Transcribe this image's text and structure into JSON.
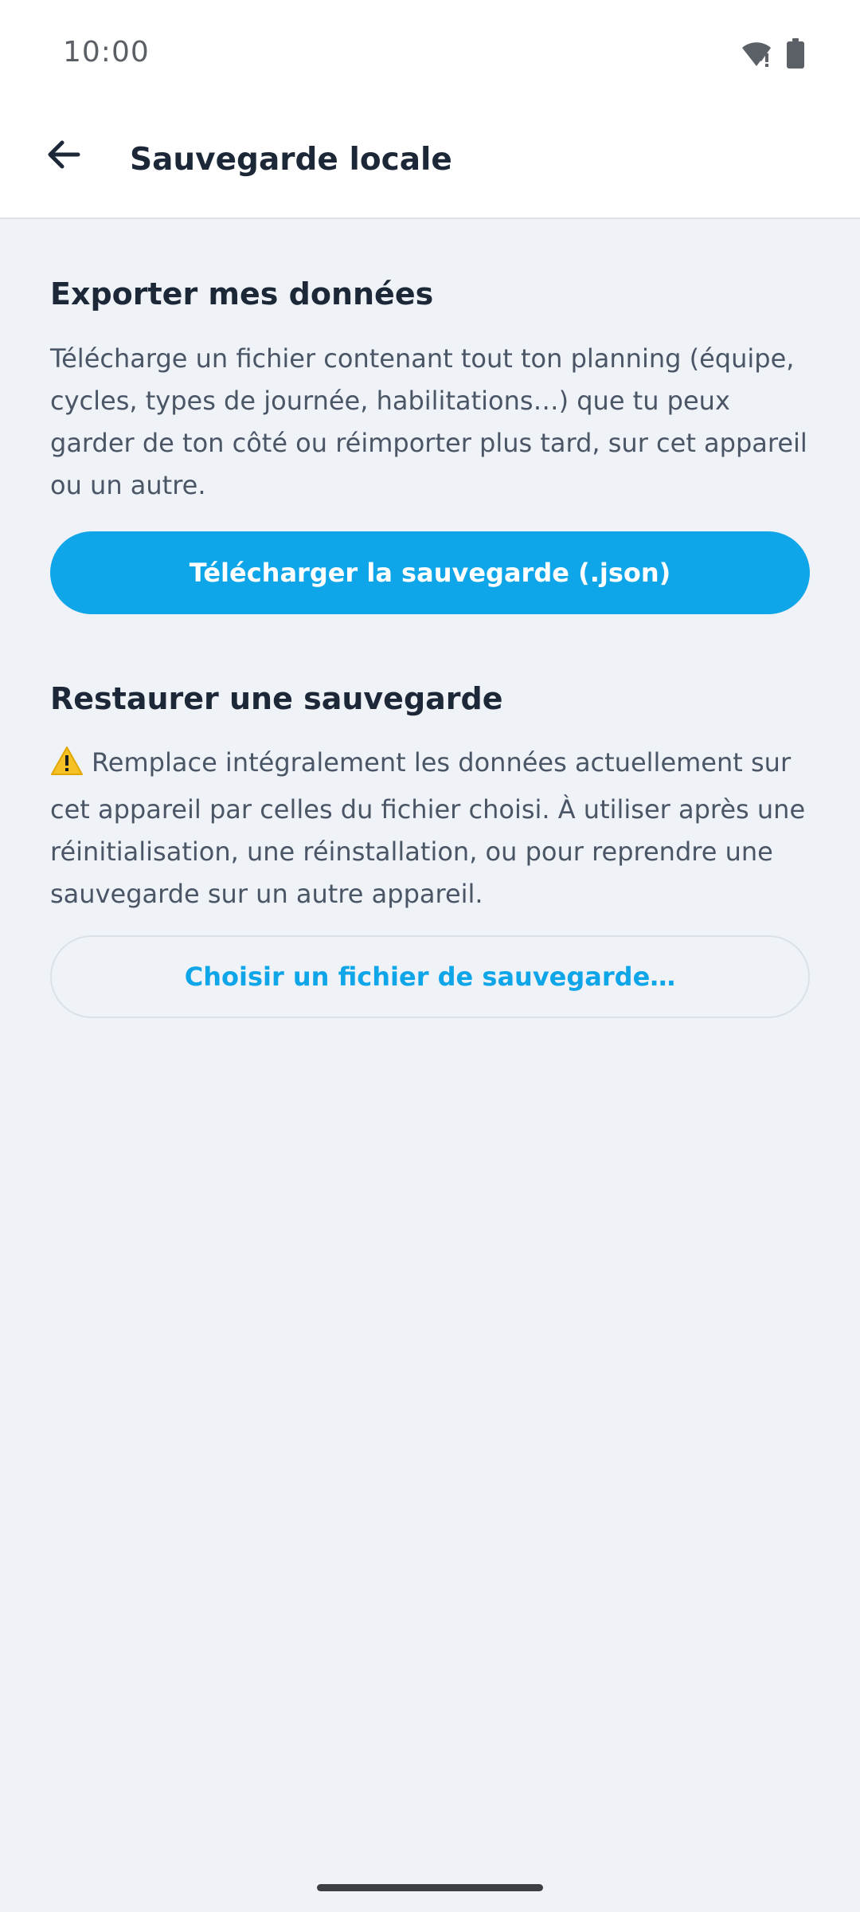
{
  "status": {
    "time": "10:00"
  },
  "header": {
    "title": "Sauvegarde locale",
    "back_icon": "arrow-left-icon"
  },
  "export": {
    "title": "Exporter mes données",
    "description": "Télécharge un fichier contenant tout ton planning (équipe, cycles, types de journée, habilitations…) que tu peux garder de ton côté ou réimporter plus tard, sur cet appareil ou un autre.",
    "button_label": "Télécharger la sauvegarde (.json)"
  },
  "restore": {
    "title": "Restaurer une sauvegarde",
    "description": "Remplace intégralement les données actuellement sur cet appareil par celles du fichier choisi. À utiliser après une réinitialisation, une réinstallation, ou pour reprendre une sauvegarde sur un autre appareil.",
    "button_label": "Choisir un fichier de sauvegarde…",
    "warning_icon": "warning-icon"
  },
  "colors": {
    "accent": "#0ea5e9",
    "background": "#eff2f6",
    "text": "#1c2838"
  }
}
